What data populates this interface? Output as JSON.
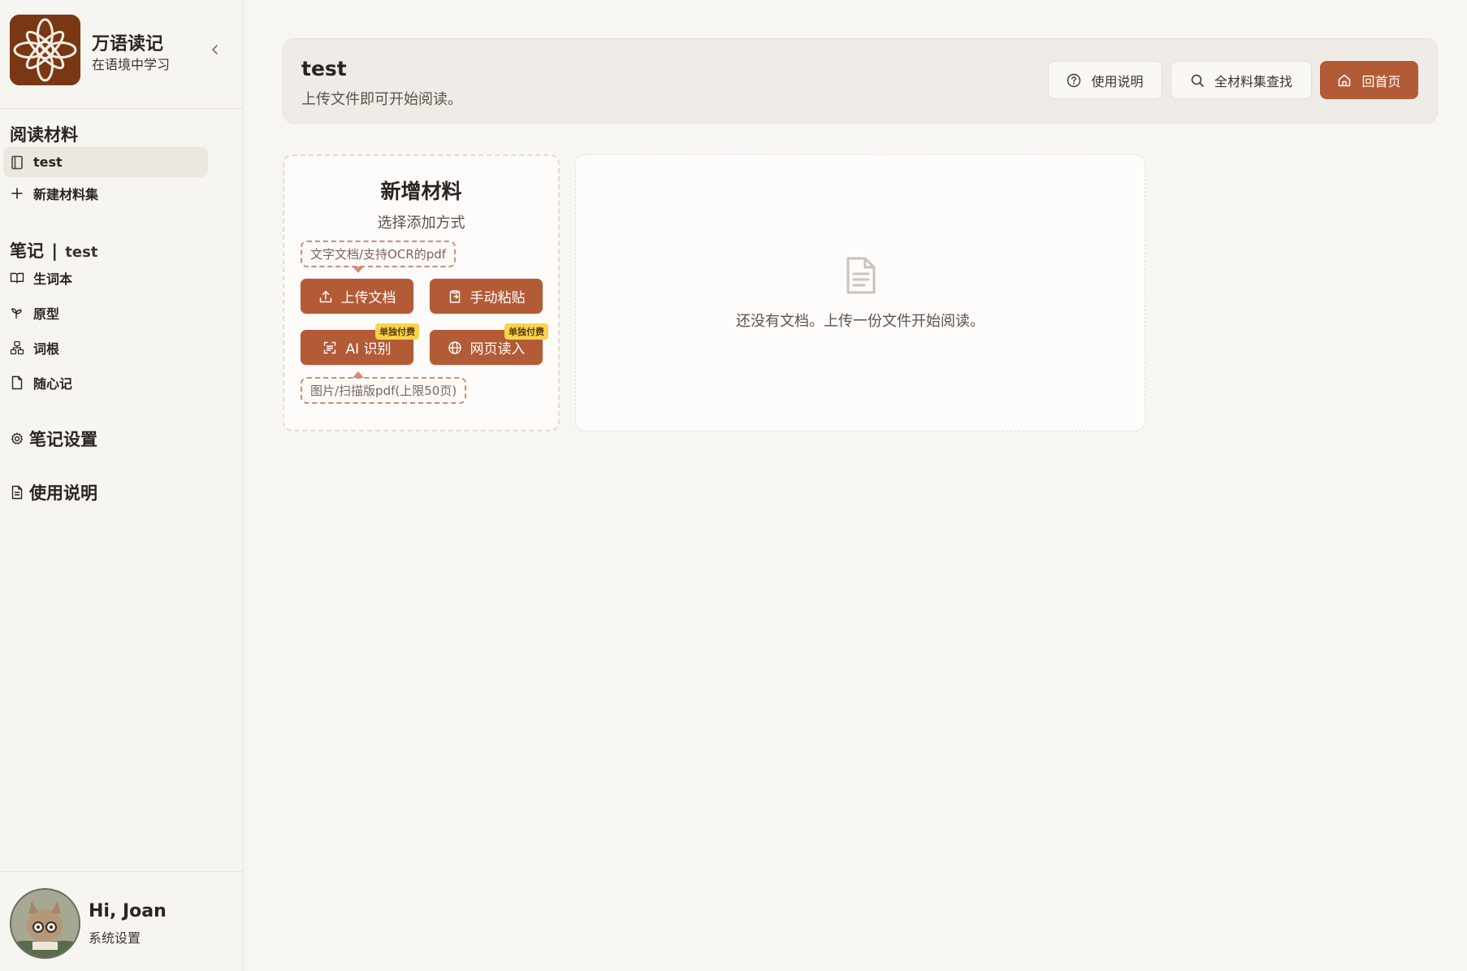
{
  "brand": {
    "title": "万语读记",
    "subtitle": "在语境中学习"
  },
  "sidebar": {
    "materials_title": "阅读材料",
    "materials": [
      {
        "label": "test"
      }
    ],
    "new_collection": "新建材料集",
    "notes_title": "笔记",
    "notes_sep": "|",
    "notes_context": "test",
    "notes": [
      {
        "label": "生词本",
        "icon": "book-open-icon"
      },
      {
        "label": "原型",
        "icon": "sprout-icon"
      },
      {
        "label": "词根",
        "icon": "network-icon"
      },
      {
        "label": "随心记",
        "icon": "file-icon"
      }
    ],
    "note_settings": "笔记设置",
    "usage_guide": "使用说明"
  },
  "user": {
    "greeting": "Hi, Joan",
    "settings_label": "系统设置"
  },
  "header": {
    "title": "test",
    "subtitle": "上传文件即可开始阅读。",
    "help_label": "使用说明",
    "search_label": "全材料集查找",
    "home_label": "回首页"
  },
  "add_card": {
    "title": "新增材料",
    "subtitle": "选择添加方式",
    "text_hint": "文字文档/支持OCR的pdf",
    "upload_label": "上传文档",
    "paste_label": "手动粘贴",
    "ai_label": "AI 识别",
    "web_label": "网页读入",
    "paid_badge": "单独付费",
    "image_hint": "图片/扫描版pdf(上限50页)"
  },
  "doc_panel": {
    "empty_text": "还没有文档。上传一份文件开始阅读。"
  },
  "colors": {
    "accent": "#b35a36",
    "badge": "#f6d34a",
    "brand_bg": "#7a3714"
  }
}
